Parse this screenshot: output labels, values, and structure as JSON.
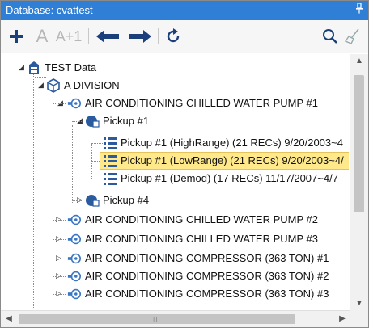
{
  "panel": {
    "title": "Database: cvattest",
    "pin_icon": "pin-icon",
    "title_color": "#2f7fd6"
  },
  "toolbar": {
    "add_icon": "plus-icon",
    "font_label": "A",
    "font_inc_label": "A+1",
    "back_icon": "arrow-left-icon",
    "forward_icon": "arrow-right-icon",
    "refresh_icon": "refresh-icon",
    "search_icon": "search-icon",
    "clear_icon": "broom-icon"
  },
  "tree": {
    "root": {
      "label": "TEST Data",
      "icon": "database-icon"
    },
    "division": {
      "label": "A DIVISION",
      "icon": "cube-icon"
    },
    "machines": [
      {
        "label": "AIR CONDITIONING CHILLED WATER PUMP #1",
        "expanded": true
      },
      {
        "label": "AIR CONDITIONING CHILLED WATER PUMP #2",
        "expanded": false
      },
      {
        "label": "AIR CONDITIONING CHILLED WATER PUMP #3",
        "expanded": false
      },
      {
        "label": "AIR CONDITIONING COMPRESSOR (363 TON) #1",
        "expanded": false
      },
      {
        "label": "AIR CONDITIONING COMPRESSOR (363 TON) #2",
        "expanded": false
      },
      {
        "label": "AIR CONDITIONING COMPRESSOR (363 TON) #3",
        "expanded": false
      }
    ],
    "pickups": [
      {
        "label": "Pickup #1",
        "expanded": true
      },
      {
        "label": "Pickup #4",
        "expanded": false
      }
    ],
    "datasets": [
      {
        "label": "Pickup #1 (HighRange) (21 RECs) 9/20/2003~4",
        "selected": false
      },
      {
        "label": "Pickup #1 (LowRange) (21 RECs) 9/20/2003~4/",
        "selected": true
      },
      {
        "label": "Pickup #1 (Demod) (17 RECs) 11/17/2007~4/7",
        "selected": false
      }
    ]
  },
  "scrollbars": {
    "grip": "III"
  }
}
